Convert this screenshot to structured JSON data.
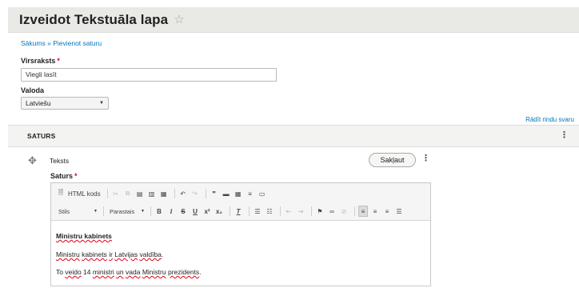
{
  "page": {
    "title": "Izveidot Tekstuāla lapa",
    "star_icon": "star-outline-icon"
  },
  "breadcrumb": {
    "home": "Sākums",
    "separator": "»",
    "current": "Pievienot saturu"
  },
  "form": {
    "title_label": "Virsraksts",
    "title_value": "Viegli lasīt",
    "required_mark": "*",
    "language_label": "Valoda",
    "language_value": "Latviešu",
    "row_weights_link": "Rādīt rindu svaru"
  },
  "section": {
    "title": "SATURS"
  },
  "paragraph": {
    "type_label": "Teksts",
    "collapse_label": "Sakļaut",
    "field_label": "Saturs"
  },
  "editor": {
    "source_label": "HTML kods",
    "style_dropdown": "Stils",
    "format_dropdown": "Parastais",
    "content": {
      "heading": "Ministru kabinets",
      "line1_parts": [
        "Ministru",
        " ",
        "kabinets",
        " ",
        "ir",
        " ",
        "Latvijas",
        " ",
        "valdība",
        "."
      ],
      "line2_parts": [
        "To",
        " ",
        "veido",
        " 14 ",
        "ministri",
        " ",
        "un",
        " ",
        "vada",
        " ",
        "Ministru",
        " ",
        "prezidents",
        "."
      ]
    }
  },
  "colors": {
    "link": "#0074bd",
    "required": "#e2001a",
    "header_bg": "#e9e9e6"
  }
}
